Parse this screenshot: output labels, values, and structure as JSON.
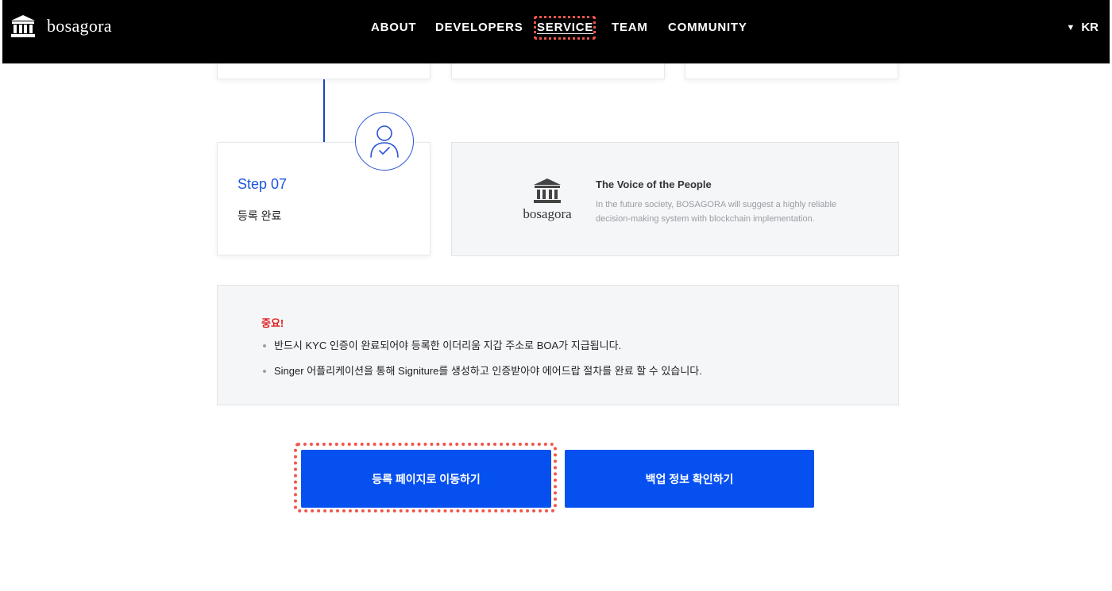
{
  "header": {
    "logo_text": "bosagora",
    "nav": [
      {
        "label": "ABOUT"
      },
      {
        "label": "DEVELOPERS"
      },
      {
        "label": "SERVICE"
      },
      {
        "label": "TEAM"
      },
      {
        "label": "COMMUNITY"
      }
    ],
    "language": "KR"
  },
  "step": {
    "title": "Step 07",
    "description": "등록 완료"
  },
  "info": {
    "logo_text": "bosagora",
    "title": "The Voice of the People",
    "text": "In the future society, BOSAGORA will suggest a highly reliable decision-making system with blockchain implementation."
  },
  "notice": {
    "title": "중요!",
    "items": [
      "반드시 KYC 인증이 완료되어야 등록한 이더리움 지갑 주소로 BOA가 지급됩니다.",
      "Singer 어플리케이션을 통해 Signiture를 생성하고 인증받아야 에어드랍 절차를 완료 할 수 있습니다."
    ]
  },
  "buttons": {
    "register": "등록 페이지로 이동하기",
    "backup": "백업 정보 확인하기"
  },
  "colors": {
    "header_bg": "#000000",
    "accent_blue": "#0650f0",
    "step_title": "#1c55e0",
    "notice_red": "#e02020",
    "highlight": "#f0554a"
  }
}
